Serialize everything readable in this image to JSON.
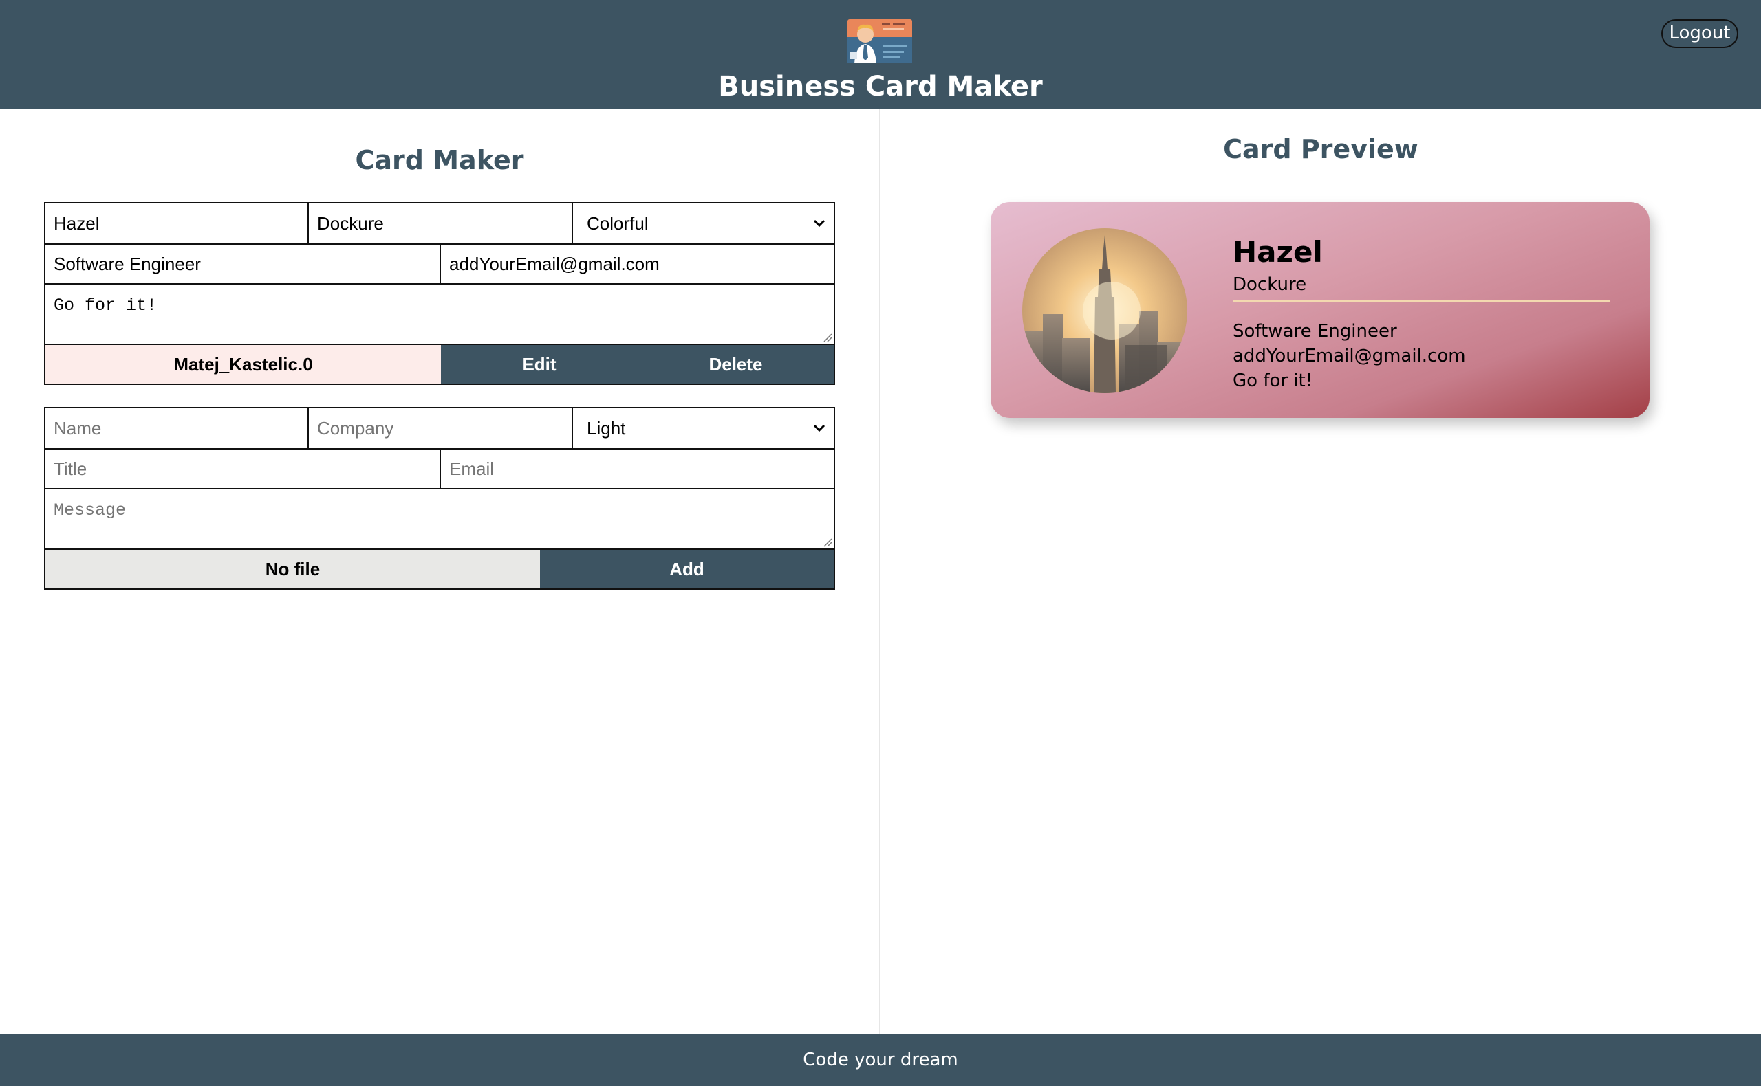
{
  "header": {
    "title": "Business Card Maker",
    "logout_label": "Logout",
    "logo_icon": "business-card-logo"
  },
  "maker": {
    "title": "Card Maker",
    "existing_card": {
      "name": "Hazel",
      "company": "Dockure",
      "theme": "Colorful",
      "title": "Software Engineer",
      "email": "addYourEmail@gmail.com",
      "message": "Go for it!",
      "file_label": "Matej_Kastelic.0",
      "edit_label": "Edit",
      "delete_label": "Delete"
    },
    "new_card": {
      "name_placeholder": "Name",
      "company_placeholder": "Company",
      "theme": "Light",
      "title_placeholder": "Title",
      "email_placeholder": "Email",
      "message_placeholder": "Message",
      "file_label": "No file",
      "add_label": "Add"
    }
  },
  "preview": {
    "title": "Card Preview",
    "card": {
      "name": "Hazel",
      "company": "Dockure",
      "title": "Software Engineer",
      "email": "addYourEmail@gmail.com",
      "message": "Go for it!",
      "theme": "Colorful",
      "photo": "city-skyline-photo"
    }
  },
  "footer": {
    "text": "Code your dream"
  },
  "colors": {
    "primary": "#3d5462",
    "file_selected_bg": "#fdecea",
    "no_file_bg": "#e8e8e6",
    "card_gradient_start": "#e6bdd0",
    "card_gradient_end": "#a33f46",
    "card_divider": "#f3d9b0"
  }
}
